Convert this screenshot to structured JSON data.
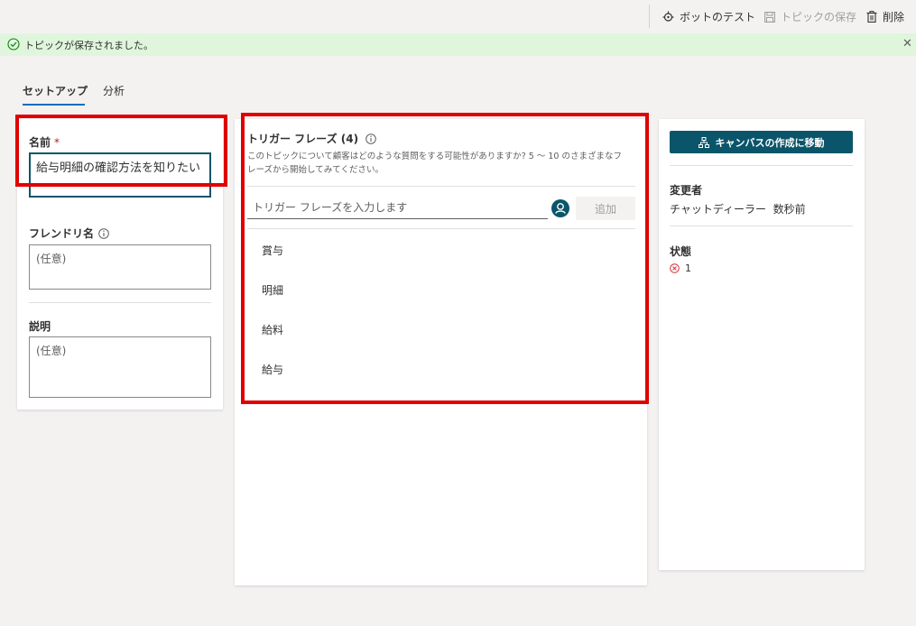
{
  "toolbar": {
    "test_bot": "ボットのテスト",
    "save_topic": "トピックの保存",
    "delete": "削除"
  },
  "message": {
    "text": "トピックが保存されました。"
  },
  "tabs": [
    "セットアップ",
    "分析"
  ],
  "left_panel": {
    "name_label": "名前",
    "required_mark": "*",
    "name_value": "給与明細の確認方法を知りたい",
    "friendly_label": "フレンドリ名",
    "friendly_placeholder": "(任意)",
    "desc_label": "説明",
    "desc_placeholder": "(任意)"
  },
  "trigger": {
    "title": "トリガー フレーズ (4)",
    "description_line1": "このトピックについて顧客はどのような質問をする可能性がありますか? 5 ～ 10 のさまざまなフ",
    "description_line2": "レーズから開始してみてください。",
    "input_placeholder": "トリガー フレーズを入力します",
    "add_label": "追加",
    "phrases": [
      "賞与",
      "明細",
      "給料",
      "給与"
    ]
  },
  "right_panel": {
    "canvas_button": "キャンバスの作成に移動",
    "modified_by_label": "変更者",
    "modified_by_value": "チャットディーラー  数秒前",
    "status_label": "状態",
    "error_count": "1"
  },
  "colors": {
    "accent": "#0b556a",
    "success_bg": "#dff6dd",
    "highlight": "#e00000",
    "error": "#d13438"
  }
}
